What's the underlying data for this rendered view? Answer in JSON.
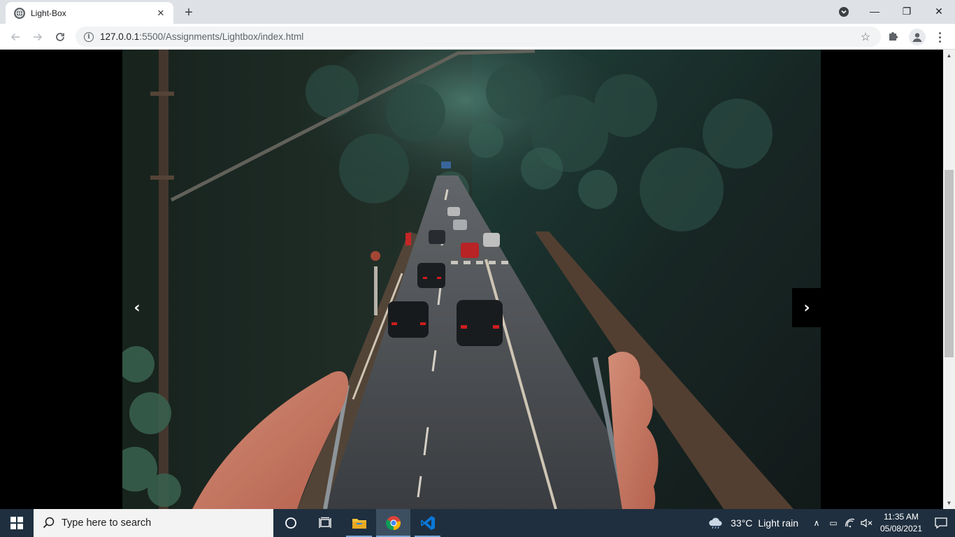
{
  "browser": {
    "tab": {
      "title": "Light-Box",
      "close_glyph": "✕"
    },
    "new_tab_glyph": "+",
    "url_host": "127.0.0.1",
    "url_rest": ":5500/Assignments/Lightbox/index.html",
    "info_glyph": "i",
    "bookmark_glyph": "☆"
  },
  "window_controls": {
    "minimize": "—",
    "maximize": "❐",
    "close": "✕"
  },
  "lightbox": {
    "prev_glyph": "‹",
    "next_glyph": "›",
    "photo_subject": "road-through-forest-held-like-phone"
  },
  "scrollbar": {
    "up_glyph": "▲",
    "down_glyph": "▼"
  },
  "taskbar": {
    "search_placeholder": "Type here to search",
    "weather_temp": "33°C",
    "weather_desc": "Light rain",
    "time": "11:35 AM",
    "date": "05/08/2021",
    "chevron_glyph": "∧",
    "battery_glyph": "▭",
    "volume_glyph": "🕨"
  },
  "colors": {
    "tabstrip": "#dee1e6",
    "taskbar": "#1f2f3f",
    "page_background": "#000000",
    "accent": "#7aa7d6"
  }
}
